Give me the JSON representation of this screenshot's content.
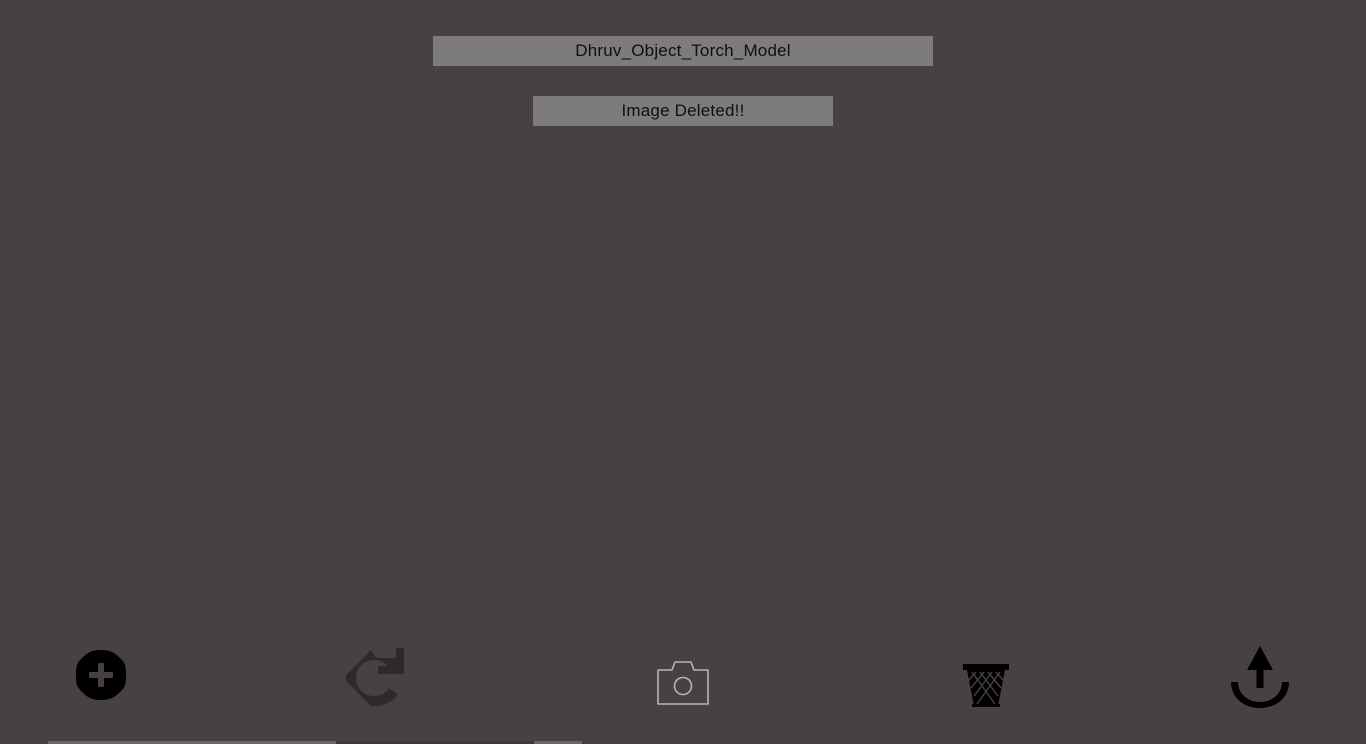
{
  "header": {
    "title": "Dhruv_Object_Torch_Model",
    "status": "Image Deleted!!"
  },
  "toolbar": {
    "buttons": [
      {
        "id": "add",
        "icon": "add-circle-icon"
      },
      {
        "id": "redo",
        "icon": "redo-arrow-icon"
      },
      {
        "id": "camera",
        "icon": "camera-icon"
      },
      {
        "id": "delete",
        "icon": "trash-basket-icon"
      },
      {
        "id": "upload",
        "icon": "upload-arrow-icon"
      }
    ]
  },
  "colors": {
    "background": "#484143",
    "label_background": "#7e7b7c",
    "icon": "#000000",
    "camera_icon": "#b8b4b5",
    "redo_icon": "#2e2a2b"
  }
}
